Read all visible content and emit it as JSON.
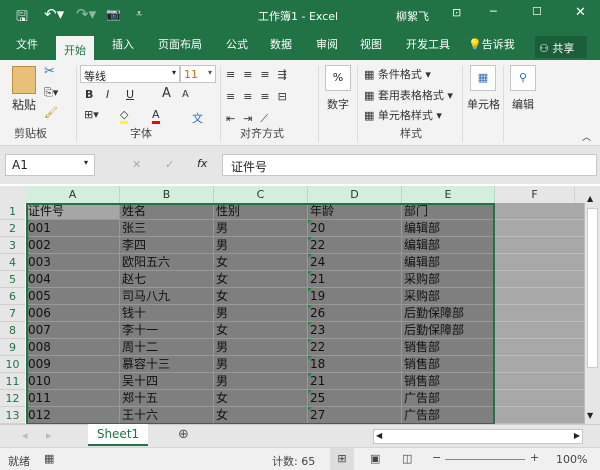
{
  "titlebar": {
    "title": "工作簿1  -  Excel",
    "user": "柳絮飞",
    "qat": [
      "save-icon",
      "undo-icon",
      "redo-icon",
      "camera-icon",
      "customize-icon"
    ]
  },
  "menu": {
    "tabs": [
      "文件",
      "开始",
      "插入",
      "页面布局",
      "公式",
      "数据",
      "审阅",
      "视图",
      "开发工具"
    ],
    "active": "开始",
    "tell_me": "告诉我",
    "share": "共享"
  },
  "ribbon": {
    "clipboard": {
      "paste": "粘贴",
      "label": "剪贴板"
    },
    "font": {
      "name": "等线",
      "size": "11",
      "label": "字体",
      "bold": "B",
      "italic": "I",
      "underline": "U",
      "grow": "A",
      "shrink": "A",
      "color": "A",
      "phonetic": "文",
      "fill_color": "#ffff00",
      "font_color": "#ff0000"
    },
    "alignment": {
      "label": "对齐方式"
    },
    "number": {
      "button": "数字",
      "symbol": "%"
    },
    "styles": {
      "conditional": "条件格式",
      "table": "套用表格格式",
      "cell_styles": "单元格样式",
      "label": "样式"
    },
    "cells": {
      "button": "单元格"
    },
    "editing": {
      "button": "编辑"
    }
  },
  "formula_bar": {
    "name_box": "A1",
    "fx": "fx",
    "value": "证件号"
  },
  "sheet": {
    "columns": [
      "A",
      "B",
      "C",
      "D",
      "E",
      "F"
    ],
    "rows": [
      [
        "证件号",
        "姓名",
        "性别",
        "年龄",
        "部门"
      ],
      [
        "001",
        "张三",
        "男",
        "20",
        "编辑部"
      ],
      [
        "002",
        "李四",
        "男",
        "22",
        "编辑部"
      ],
      [
        "003",
        "欧阳五六",
        "女",
        "24",
        "编辑部"
      ],
      [
        "004",
        "赵七",
        "女",
        "21",
        "采购部"
      ],
      [
        "005",
        "司马八九",
        "女",
        "19",
        "采购部"
      ],
      [
        "006",
        "钱十",
        "男",
        "26",
        "后勤保障部"
      ],
      [
        "007",
        "李十一",
        "女",
        "23",
        "后勤保障部"
      ],
      [
        "008",
        "周十二",
        "男",
        "22",
        "销售部"
      ],
      [
        "009",
        "慕容十三",
        "男",
        "18",
        "销售部"
      ],
      [
        "010",
        "吴十四",
        "男",
        "21",
        "销售部"
      ],
      [
        "011",
        "郑十五",
        "女",
        "25",
        "广告部"
      ],
      [
        "012",
        "王十六",
        "女",
        "27",
        "广告部"
      ]
    ],
    "tab": "Sheet1"
  },
  "status": {
    "ready": "就绪",
    "count": "计数: 65",
    "zoom": "100%"
  }
}
